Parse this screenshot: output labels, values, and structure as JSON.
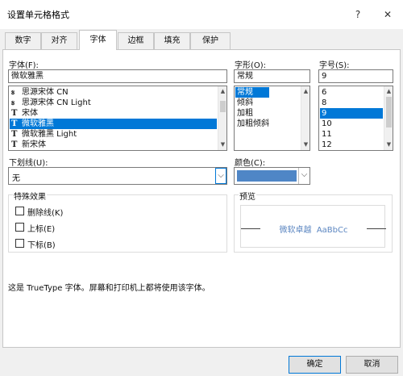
{
  "window": {
    "title": "设置单元格格式",
    "help": "?",
    "close": "✕"
  },
  "tabs": [
    {
      "label": "数字"
    },
    {
      "label": "对齐"
    },
    {
      "label": "字体"
    },
    {
      "label": "边框"
    },
    {
      "label": "填充"
    },
    {
      "label": "保护"
    }
  ],
  "font": {
    "label": "字体(F):",
    "value": "微软雅黑",
    "items": [
      {
        "label": "思源宋体 CN"
      },
      {
        "label": "思源宋体 CN Light"
      },
      {
        "label": "宋体"
      },
      {
        "label": "微软雅黑"
      },
      {
        "label": "微软雅黑 Light"
      },
      {
        "label": "新宋体"
      }
    ]
  },
  "style": {
    "label": "字形(O):",
    "value": "常规",
    "items": [
      {
        "label": "常规"
      },
      {
        "label": "倾斜"
      },
      {
        "label": "加粗"
      },
      {
        "label": "加粗倾斜"
      }
    ]
  },
  "size": {
    "label": "字号(S):",
    "value": "9",
    "items": [
      {
        "label": "6"
      },
      {
        "label": "8"
      },
      {
        "label": "9"
      },
      {
        "label": "10"
      },
      {
        "label": "11"
      },
      {
        "label": "12"
      }
    ]
  },
  "underline": {
    "label": "下划线(U):",
    "value": "无"
  },
  "color": {
    "label": "颜色(C):",
    "swatch": "#4f86c6"
  },
  "effects": {
    "title": "特殊效果",
    "strikethrough": "删除线(K)",
    "superscript": "上标(E)",
    "subscript": "下标(B)"
  },
  "preview": {
    "title": "预览",
    "sample": "微软卓越  AaBbCc"
  },
  "info": "这是 TrueType 字体。屏幕和打印机上都将使用该字体。",
  "buttons": {
    "ok": "确定",
    "cancel": "取消"
  },
  "colors": {
    "accent": "#0078d7",
    "preview_text": "#5b86c1"
  }
}
